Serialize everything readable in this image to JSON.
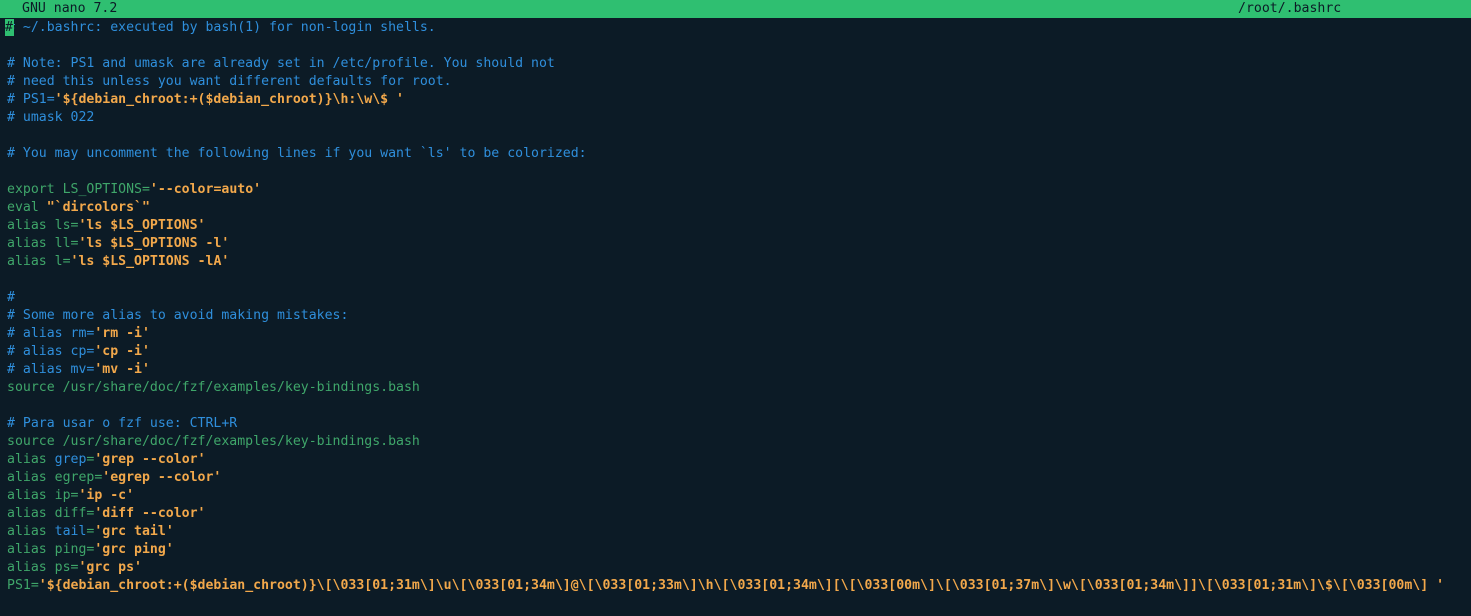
{
  "titlebar": {
    "app": "GNU nano 7.2",
    "file": "/root/.bashrc"
  },
  "colors": {
    "background": "#0c1b26",
    "titlebar": "#2fbf71",
    "comment": "#2f8fdc",
    "keyword": "#3fa66a",
    "string": "#f2a84b"
  },
  "cursor_char": "#",
  "lines": [
    [
      {
        "t": "# ~/.bashrc: executed by bash(1) for non-login shells.",
        "c": "comment"
      }
    ],
    [],
    [
      {
        "t": "# Note: PS1 and umask are already set in /etc/profile. You should not",
        "c": "comment"
      }
    ],
    [
      {
        "t": "# need this unless you want different defaults for root.",
        "c": "comment"
      }
    ],
    [
      {
        "t": "# PS1=",
        "c": "comment"
      },
      {
        "t": "'${debian_chroot:+($debian_chroot)}\\h:\\w\\$ '",
        "c": "str"
      }
    ],
    [
      {
        "t": "# umask 022",
        "c": "comment"
      }
    ],
    [],
    [
      {
        "t": "# You may uncomment the following lines if you want `ls' to be colorized:",
        "c": "comment"
      }
    ],
    [],
    [
      {
        "t": "export LS_OPTIONS=",
        "c": "kw"
      },
      {
        "t": "'--color=auto'",
        "c": "str"
      }
    ],
    [
      {
        "t": "eval ",
        "c": "kw"
      },
      {
        "t": "\"`dircolors`\"",
        "c": "str"
      }
    ],
    [
      {
        "t": "alias ls=",
        "c": "kw"
      },
      {
        "t": "'ls $LS_OPTIONS'",
        "c": "str"
      }
    ],
    [
      {
        "t": "alias ll=",
        "c": "kw"
      },
      {
        "t": "'ls $LS_OPTIONS -l'",
        "c": "str"
      }
    ],
    [
      {
        "t": "alias l=",
        "c": "kw"
      },
      {
        "t": "'ls $LS_OPTIONS -lA'",
        "c": "str"
      }
    ],
    [],
    [
      {
        "t": "#",
        "c": "comment"
      }
    ],
    [
      {
        "t": "# Some more alias to avoid making mistakes:",
        "c": "comment"
      }
    ],
    [
      {
        "t": "# alias rm=",
        "c": "comment"
      },
      {
        "t": "'rm -i'",
        "c": "str"
      }
    ],
    [
      {
        "t": "# alias cp=",
        "c": "comment"
      },
      {
        "t": "'cp -i'",
        "c": "str"
      }
    ],
    [
      {
        "t": "# alias mv=",
        "c": "comment"
      },
      {
        "t": "'mv -i'",
        "c": "str"
      }
    ],
    [
      {
        "t": "source /usr/share/doc/fzf/examples/key-bindings.bash",
        "c": "kw"
      }
    ],
    [],
    [
      {
        "t": "# Para usar o fzf use: CTRL+R",
        "c": "comment"
      }
    ],
    [
      {
        "t": "source /usr/share/doc/fzf/examples/key-bindings.bash",
        "c": "kw"
      }
    ],
    [
      {
        "t": "alias ",
        "c": "kw"
      },
      {
        "t": "grep",
        "c": "var"
      },
      {
        "t": "=",
        "c": "kw"
      },
      {
        "t": "'grep --color'",
        "c": "str"
      }
    ],
    [
      {
        "t": "alias egrep=",
        "c": "kw"
      },
      {
        "t": "'egrep --color'",
        "c": "str"
      }
    ],
    [
      {
        "t": "alias ip=",
        "c": "kw"
      },
      {
        "t": "'ip -c'",
        "c": "str"
      }
    ],
    [
      {
        "t": "alias diff=",
        "c": "kw"
      },
      {
        "t": "'diff --color'",
        "c": "str"
      }
    ],
    [
      {
        "t": "alias ",
        "c": "kw"
      },
      {
        "t": "tail",
        "c": "var"
      },
      {
        "t": "=",
        "c": "kw"
      },
      {
        "t": "'grc tail'",
        "c": "str"
      }
    ],
    [
      {
        "t": "alias ping=",
        "c": "kw"
      },
      {
        "t": "'grc ping'",
        "c": "str"
      }
    ],
    [
      {
        "t": "alias ps=",
        "c": "kw"
      },
      {
        "t": "'grc ps'",
        "c": "str"
      }
    ],
    [
      {
        "t": "PS1=",
        "c": "kw"
      },
      {
        "t": "'${debian_chroot:+($debian_chroot)}\\[\\033[01;31m\\]\\u\\[\\033[01;34m\\]@\\[\\033[01;33m\\]\\h\\[\\033[01;34m\\][\\[\\033[00m\\]\\[\\033[01;37m\\]\\w\\[\\033[01;34m\\]]\\[\\033[01;31m\\]\\$\\[\\033[00m\\] '",
        "c": "str"
      }
    ]
  ]
}
